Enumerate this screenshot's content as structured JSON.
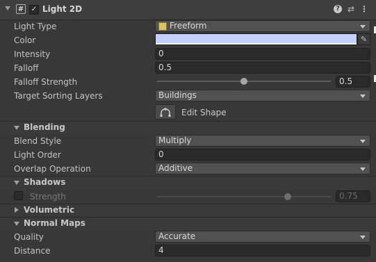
{
  "component": {
    "title": "Light 2D",
    "enabled_mark": "✓",
    "script_glyph": "#",
    "header_icons": [
      "help-icon",
      "preset-icon",
      "more-icon"
    ]
  },
  "properties": {
    "light_type": {
      "label": "Light Type",
      "value": "Freeform"
    },
    "color": {
      "label": "Color",
      "value": "#c4ceff"
    },
    "intensity": {
      "label": "Intensity",
      "value": "0"
    },
    "falloff": {
      "label": "Falloff",
      "value": "0.5"
    },
    "falloff_strength": {
      "label": "Falloff Strength",
      "value": "0.5",
      "fraction": 0.5
    },
    "target_sorting_layers": {
      "label": "Target Sorting Layers",
      "value": "Buildings"
    },
    "edit_shape": {
      "label": "Edit Shape"
    }
  },
  "blending": {
    "title": "Blending",
    "blend_style": {
      "label": "Blend Style",
      "value": "Multiply"
    },
    "light_order": {
      "label": "Light Order",
      "value": "0"
    },
    "overlap_operation": {
      "label": "Overlap Operation",
      "value": "Additive"
    }
  },
  "shadows": {
    "title": "Shadows",
    "strength": {
      "label": "Strength",
      "value": "0.75",
      "fraction": 0.75,
      "enabled": false
    }
  },
  "volumetric": {
    "title": "Volumetric"
  },
  "normal_maps": {
    "title": "Normal Maps",
    "quality": {
      "label": "Quality",
      "value": "Accurate"
    },
    "distance": {
      "label": "Distance",
      "value": "4"
    }
  }
}
